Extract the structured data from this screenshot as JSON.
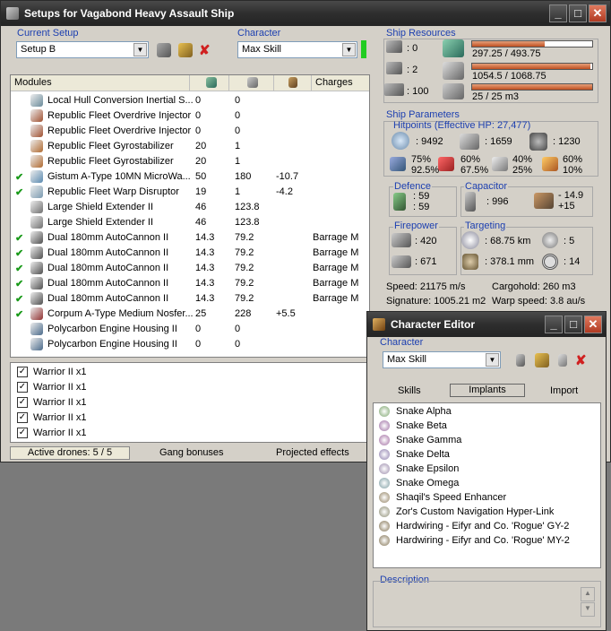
{
  "main_window": {
    "title": "Setups for Vagabond Heavy Assault Ship",
    "current_setup_label": "Current Setup",
    "current_setup_value": "Setup B",
    "character_label": "Character",
    "character_value": "Max Skill",
    "columns": {
      "modules": "Modules",
      "charges": "Charges"
    },
    "modules": [
      {
        "check": "",
        "name": "Local Hull Conversion Inertial S...",
        "c1": "0",
        "c2": "0",
        "c3": "",
        "charge": "",
        "icon": "hull-icon",
        "color": "#6a8a9a"
      },
      {
        "check": "",
        "name": "Republic Fleet Overdrive Injector",
        "c1": "0",
        "c2": "0",
        "c3": "",
        "charge": "",
        "icon": "injector-icon",
        "color": "#a05030"
      },
      {
        "check": "",
        "name": "Republic Fleet Overdrive Injector",
        "c1": "0",
        "c2": "0",
        "c3": "",
        "charge": "",
        "icon": "injector-icon",
        "color": "#a05030"
      },
      {
        "check": "",
        "name": "Republic Fleet Gyrostabilizer",
        "c1": "20",
        "c2": "1",
        "c3": "",
        "charge": "",
        "icon": "gyro-icon",
        "color": "#b06a30"
      },
      {
        "check": "",
        "name": "Republic Fleet Gyrostabilizer",
        "c1": "20",
        "c2": "1",
        "c3": "",
        "charge": "",
        "icon": "gyro-icon",
        "color": "#b06a30"
      },
      {
        "check": "✔",
        "name": "Gistum A-Type 10MN MicroWa...",
        "c1": "50",
        "c2": "180",
        "c3": "-10.7",
        "charge": "",
        "icon": "mwd-icon",
        "color": "#5a8ab0"
      },
      {
        "check": "✔",
        "name": "Republic Fleet Warp Disruptor",
        "c1": "19",
        "c2": "1",
        "c3": "-4.2",
        "charge": "",
        "icon": "disruptor-icon",
        "color": "#7a9ab0"
      },
      {
        "check": "",
        "name": "Large Shield Extender II",
        "c1": "46",
        "c2": "123.8",
        "c3": "",
        "charge": "",
        "icon": "shield-extender-icon",
        "color": "#707070"
      },
      {
        "check": "",
        "name": "Large Shield Extender II",
        "c1": "46",
        "c2": "123.8",
        "c3": "",
        "charge": "",
        "icon": "shield-extender-icon",
        "color": "#707070"
      },
      {
        "check": "✔",
        "name": "Dual 180mm AutoCannon II",
        "c1": "14.3",
        "c2": "79.2",
        "c3": "",
        "charge": "Barrage M",
        "icon": "autocannon-icon",
        "color": "#505050"
      },
      {
        "check": "✔",
        "name": "Dual 180mm AutoCannon II",
        "c1": "14.3",
        "c2": "79.2",
        "c3": "",
        "charge": "Barrage M",
        "icon": "autocannon-icon",
        "color": "#505050"
      },
      {
        "check": "✔",
        "name": "Dual 180mm AutoCannon II",
        "c1": "14.3",
        "c2": "79.2",
        "c3": "",
        "charge": "Barrage M",
        "icon": "autocannon-icon",
        "color": "#505050"
      },
      {
        "check": "✔",
        "name": "Dual 180mm AutoCannon II",
        "c1": "14.3",
        "c2": "79.2",
        "c3": "",
        "charge": "Barrage M",
        "icon": "autocannon-icon",
        "color": "#505050"
      },
      {
        "check": "✔",
        "name": "Dual 180mm AutoCannon II",
        "c1": "14.3",
        "c2": "79.2",
        "c3": "",
        "charge": "Barrage M",
        "icon": "autocannon-icon",
        "color": "#505050"
      },
      {
        "check": "✔",
        "name": "Corpum A-Type Medium Nosfer...",
        "c1": "25",
        "c2": "228",
        "c3": "+5.5",
        "charge": "",
        "icon": "nosferatu-icon",
        "color": "#903030"
      },
      {
        "check": "",
        "name": "Polycarbon Engine Housing II",
        "c1": "0",
        "c2": "0",
        "c3": "",
        "charge": "",
        "icon": "rig-icon",
        "color": "#4a6a8a"
      },
      {
        "check": "",
        "name": "Polycarbon Engine Housing II",
        "c1": "0",
        "c2": "0",
        "c3": "",
        "charge": "",
        "icon": "rig-icon",
        "color": "#4a6a8a"
      }
    ],
    "drones": [
      "Warrior II x1",
      "Warrior II x1",
      "Warrior II x1",
      "Warrior II x1",
      "Warrior II x1"
    ],
    "footer": {
      "active_drones": "Active drones: 5 / 5",
      "gang_bonuses": "Gang bonuses",
      "projected_effects": "Projected effects"
    }
  },
  "ship_resources": {
    "label": "Ship Resources",
    "turret_slots": ": 0",
    "launcher_slots": ": 2",
    "calibration": ": 100",
    "cpu": {
      "text": "297.25 / 493.75",
      "fraction": 0.602
    },
    "powergrid": {
      "text": "1054.5 / 1068.75",
      "fraction": 0.987
    },
    "drone_bay": {
      "text": "25 / 25 m3",
      "fraction": 1.0
    }
  },
  "ship_parameters": {
    "label": "Ship Parameters",
    "hitpoints_label": "Hitpoints (Effective HP: 27,477)",
    "shield_hp": ": 9492",
    "armor_hp": ": 1659",
    "structure_hp": ": 1230",
    "resists": [
      {
        "a": "75%",
        "b": "92.5%"
      },
      {
        "a": "60%",
        "b": "67.5%"
      },
      {
        "a": "40%",
        "b": "25%"
      },
      {
        "a": "60%",
        "b": "10%"
      }
    ],
    "defence_label": "Defence",
    "defence_a": ": 59",
    "defence_b": ": 59",
    "capacitor_label": "Capacitor",
    "capacitor_amount": ": 996",
    "capacitor_delta_a": "- 14.9",
    "capacitor_delta_b": "+15",
    "firepower_label": "Firepower",
    "firepower_a": ": 420",
    "firepower_b": ": 671",
    "targeting_label": "Targeting",
    "targeting_range": ": 68.75 km",
    "max_targets": ": 5",
    "scan_res": ": 378.1 mm",
    "sensor_strength": ": 14",
    "speed": "Speed: 21175 m/s",
    "cargohold": "Cargohold: 260 m3",
    "signature": "Signature: 1005.21 m2",
    "warp_speed": "Warp speed: 3.8 au/s"
  },
  "char_editor": {
    "title": "Character Editor",
    "character_label": "Character",
    "character_value": "Max Skill",
    "tabs": {
      "skills": "Skills",
      "implants": "Implants",
      "import": "Import"
    },
    "implants": [
      {
        "name": "Snake Alpha",
        "color": "#7aa36a"
      },
      {
        "name": "Snake Beta",
        "color": "#9a6aa0"
      },
      {
        "name": "Snake Gamma",
        "color": "#a06aa0"
      },
      {
        "name": "Snake Delta",
        "color": "#8a7aaa"
      },
      {
        "name": "Snake Epsilon",
        "color": "#9a8aaa"
      },
      {
        "name": "Snake Omega",
        "color": "#7a9aa0"
      },
      {
        "name": "Shaqil's Speed Enhancer",
        "color": "#908060"
      },
      {
        "name": "Zor's Custom Navigation Hyper-Link",
        "color": "#8a8a70"
      },
      {
        "name": "Hardwiring - Eifyr and Co. 'Rogue' GY-2",
        "color": "#807050"
      },
      {
        "name": "Hardwiring - Eifyr and Co. 'Rogue' MY-2",
        "color": "#807050"
      }
    ],
    "description_label": "Description"
  }
}
